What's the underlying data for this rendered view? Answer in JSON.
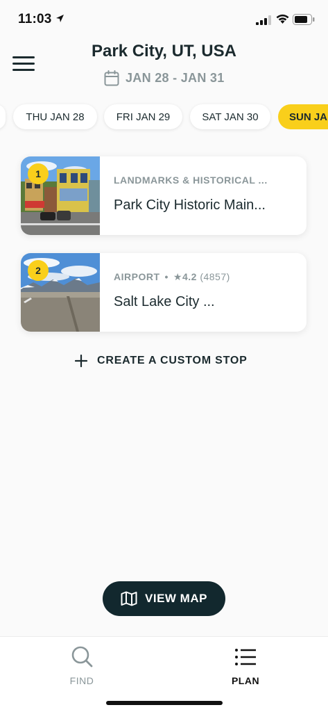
{
  "status_bar": {
    "time": "11:03"
  },
  "header": {
    "title": "Park City, UT, USA",
    "date_range": "JAN 28 - JAN 31"
  },
  "day_tabs": [
    {
      "label": "THU JAN 28",
      "active": false
    },
    {
      "label": "FRI JAN 29",
      "active": false
    },
    {
      "label": "SAT JAN 30",
      "active": false
    },
    {
      "label": "SUN JA",
      "active": true
    }
  ],
  "stops": [
    {
      "number": "1",
      "category": "LANDMARKS & HISTORICAL ...",
      "title": "Park City Historic Main..."
    },
    {
      "number": "2",
      "category": "AIRPORT",
      "rating": "★4.2",
      "review_count": "(4857)",
      "title": "Salt Lake City ..."
    }
  ],
  "custom_stop": {
    "label": "CREATE A CUSTOM STOP"
  },
  "view_map": {
    "label": "VIEW MAP"
  },
  "bottom_nav": {
    "find": {
      "label": "FIND"
    },
    "plan": {
      "label": "PLAN"
    }
  },
  "colors": {
    "accent": "#f9cf1b",
    "dark": "#12282e",
    "muted": "#8a9699"
  }
}
